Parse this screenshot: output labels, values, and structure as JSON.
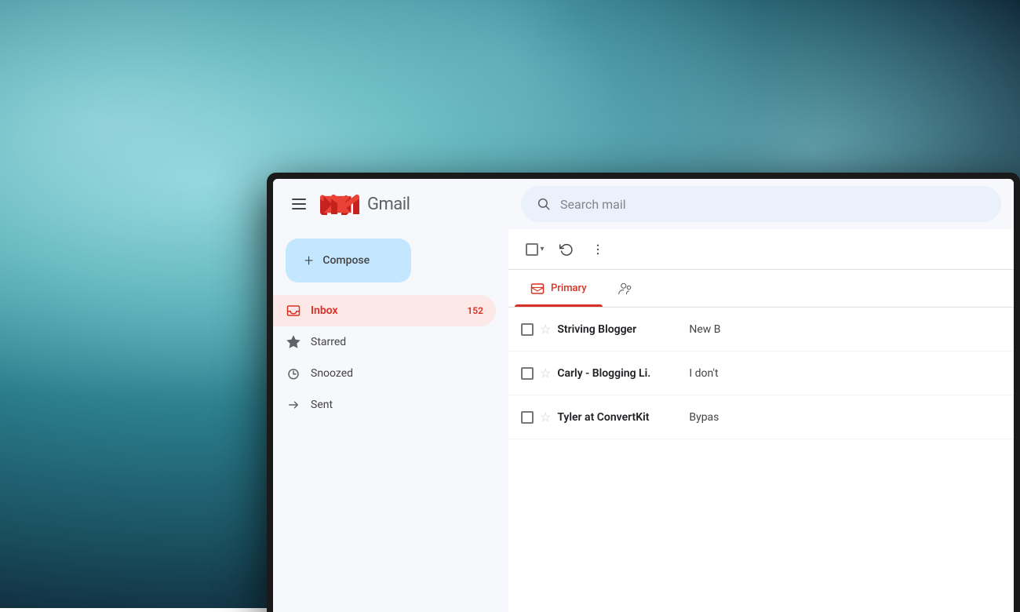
{
  "background": {
    "colors": [
      "#7ecdd4",
      "#2a7a8a",
      "#0d2030"
    ]
  },
  "header": {
    "app_name": "Gmail",
    "menu_icon": "≡",
    "search_placeholder": "Search mail"
  },
  "compose": {
    "label": "Compose",
    "plus_icon": "+"
  },
  "sidebar": {
    "items": [
      {
        "id": "inbox",
        "label": "Inbox",
        "badge": "152",
        "active": true
      },
      {
        "id": "starred",
        "label": "Starred",
        "badge": ""
      },
      {
        "id": "snoozed",
        "label": "Snoozed",
        "badge": ""
      },
      {
        "id": "sent",
        "label": "Sent",
        "badge": ""
      }
    ]
  },
  "toolbar": {
    "select_all_title": "Select all",
    "refresh_icon": "↻",
    "more_icon": "⋮"
  },
  "tabs": [
    {
      "id": "primary",
      "label": "Primary",
      "active": true
    },
    {
      "id": "social",
      "label": "S...",
      "active": false
    }
  ],
  "mail_list": {
    "rows": [
      {
        "sender": "Striving Blogger",
        "subject": "New B",
        "preview": ""
      },
      {
        "sender": "Carly - Blogging Li.",
        "subject": "I don't",
        "preview": ""
      },
      {
        "sender": "Tyler at ConvertKit",
        "subject": "Bypas",
        "preview": ""
      }
    ]
  }
}
